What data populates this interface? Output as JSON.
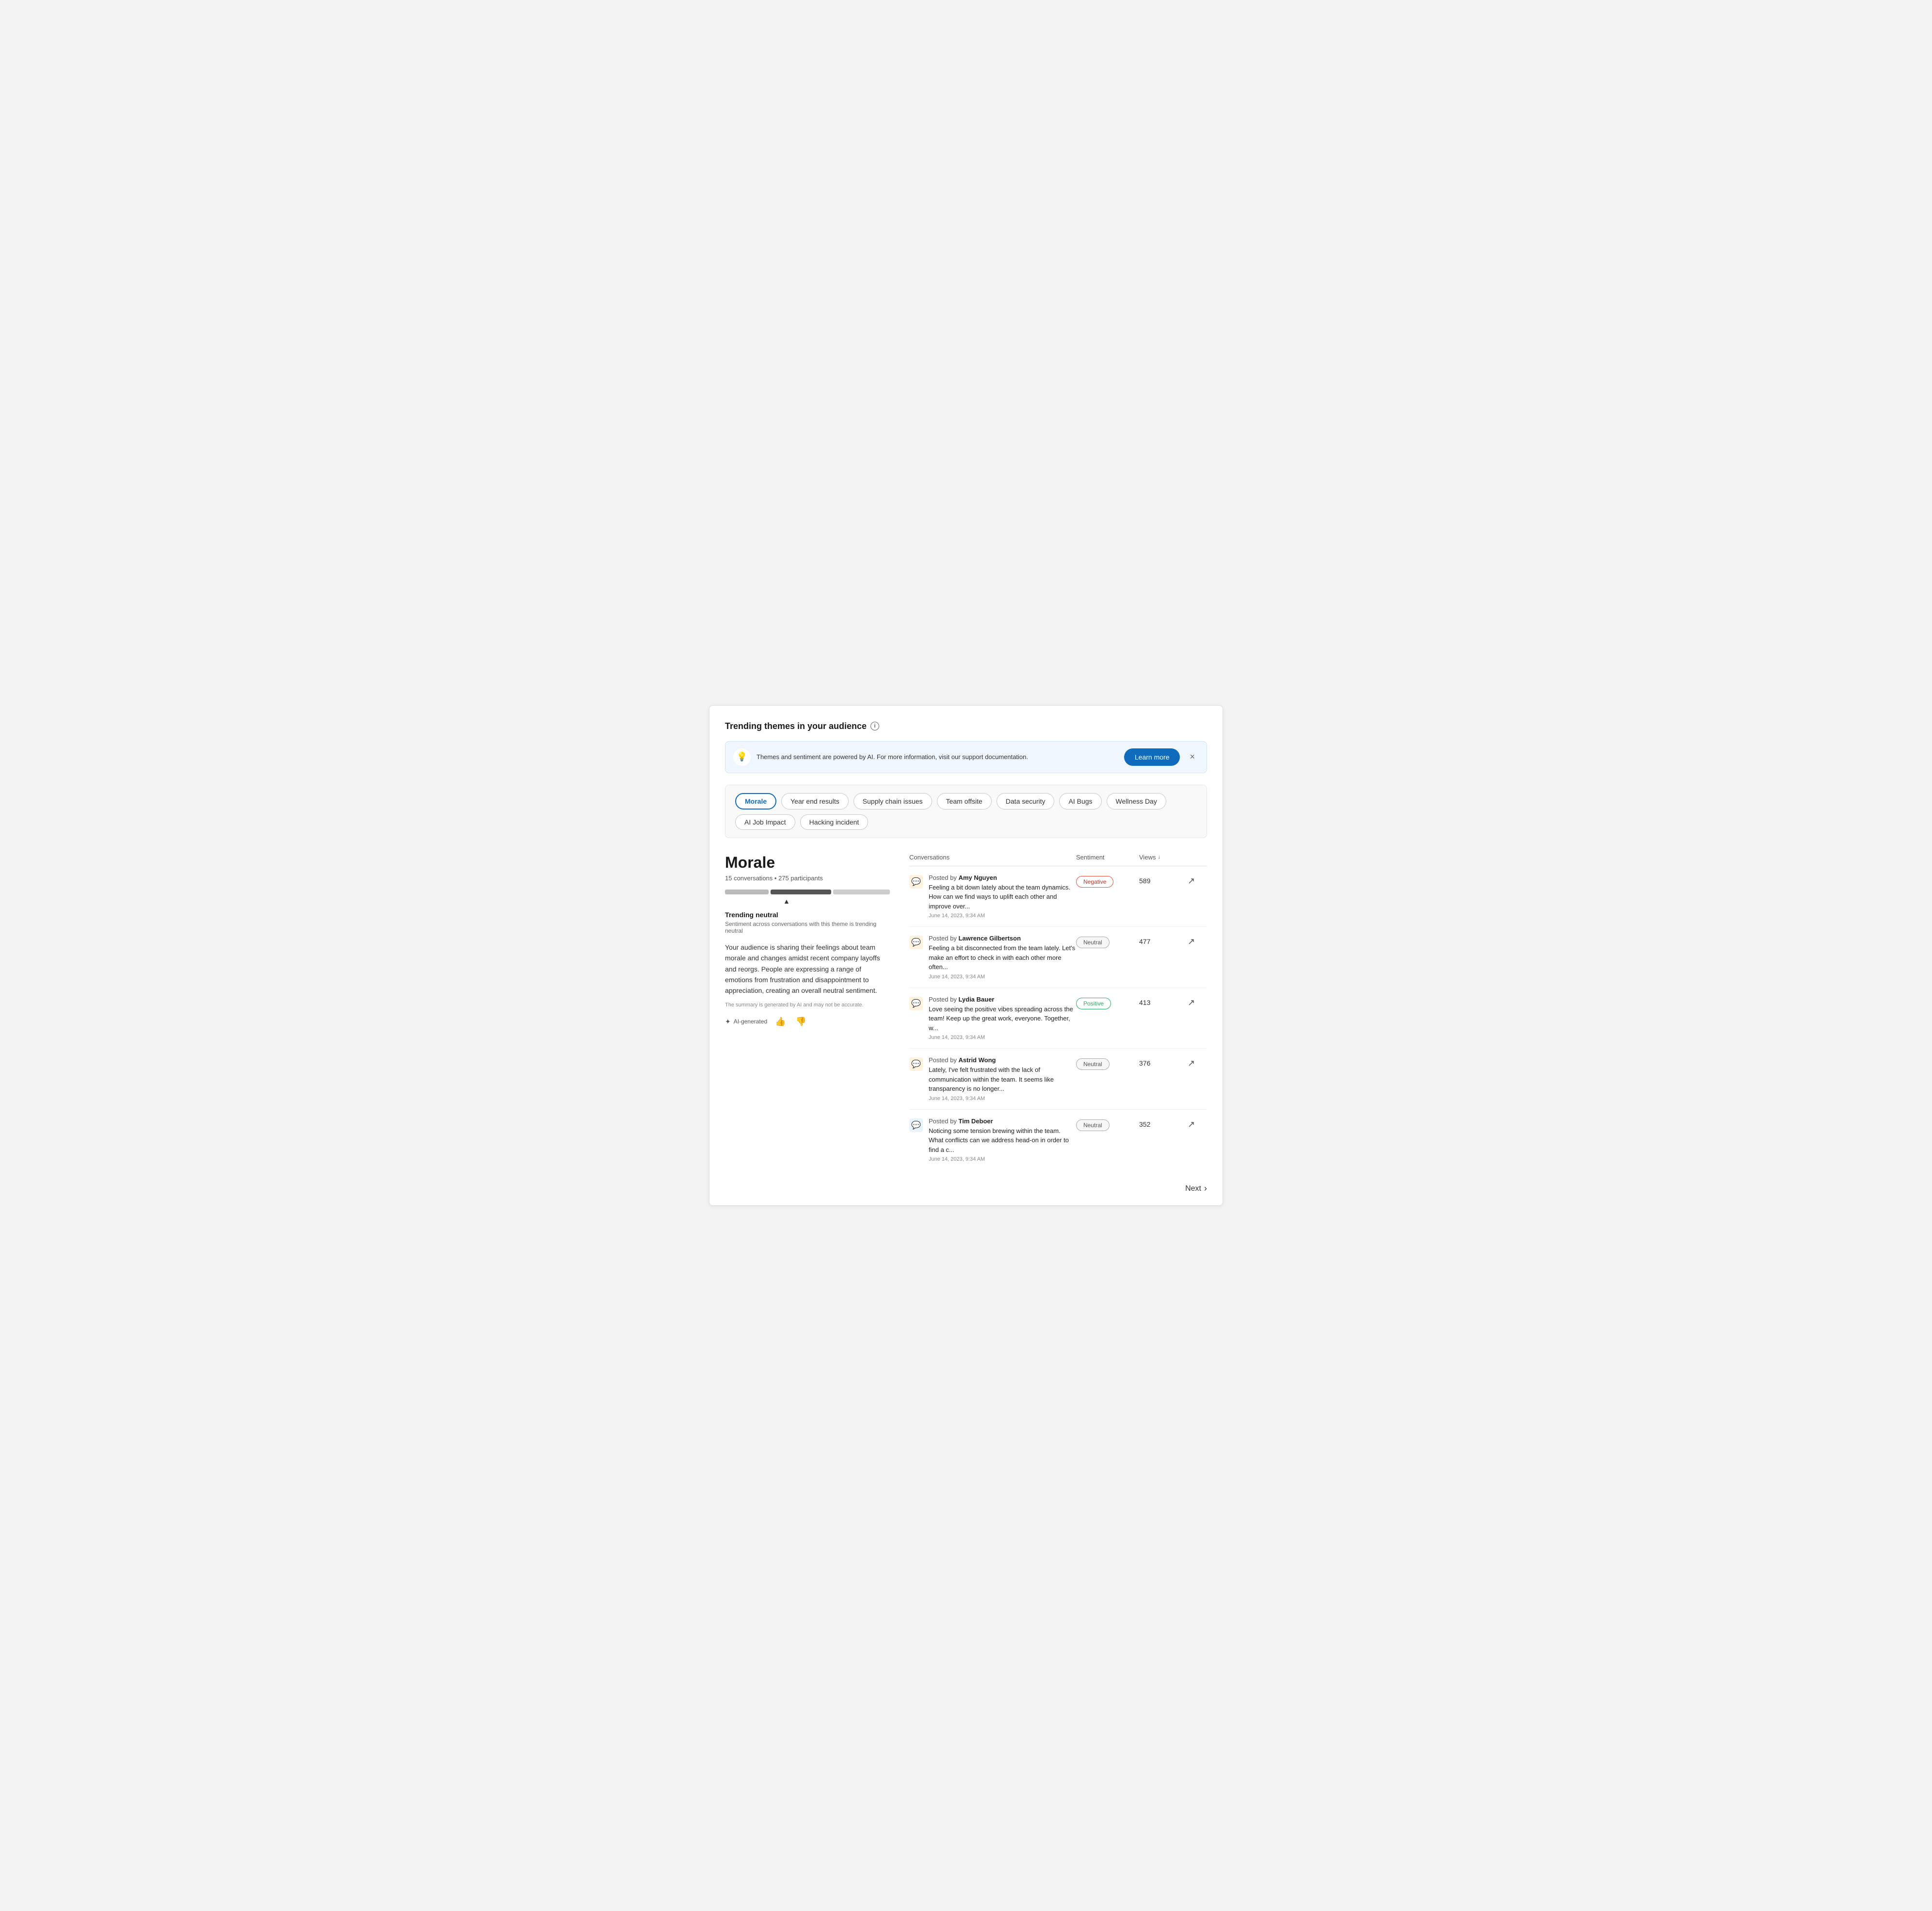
{
  "page": {
    "title": "Trending themes in your audience"
  },
  "banner": {
    "text": "Themes and sentiment are powered by AI. For more information, visit our support documentation.",
    "learn_more_label": "Learn more",
    "close_label": "×"
  },
  "themes": {
    "tags": [
      {
        "id": "morale",
        "label": "Morale",
        "active": true
      },
      {
        "id": "year-end-results",
        "label": "Year end results",
        "active": false
      },
      {
        "id": "supply-chain-issues",
        "label": "Supply chain issues",
        "active": false
      },
      {
        "id": "team-offsite",
        "label": "Team offsite",
        "active": false
      },
      {
        "id": "data-security",
        "label": "Data security",
        "active": false
      },
      {
        "id": "ai-bugs",
        "label": "AI Bugs",
        "active": false
      },
      {
        "id": "wellness-day",
        "label": "Wellness Day",
        "active": false
      },
      {
        "id": "ai-job-impact",
        "label": "AI Job Impact",
        "active": false
      },
      {
        "id": "hacking-incident",
        "label": "Hacking incident",
        "active": false
      }
    ]
  },
  "detail": {
    "title": "Morale",
    "conversations_count": "15 conversations",
    "participants_count": "275 participants",
    "trending_label": "Trending neutral",
    "trending_desc": "Sentiment across conversations with this theme is trending neutral",
    "description": "Your audience is sharing their feelings about team morale and changes amidst recent company layoffs and reorgs. People are expressing a range of emotions from frustration and disappointment to appreciation, creating an overall neutral sentiment.",
    "ai_disclaimer": "The summary is generated by AI and may not be accurate.",
    "ai_generated_label": "AI-generated",
    "thumbs_up": "👍",
    "thumbs_down": "👎"
  },
  "table": {
    "columns": {
      "conversations": "Conversations",
      "sentiment": "Sentiment",
      "views": "Views"
    },
    "rows": [
      {
        "posted_by_prefix": "Posted by",
        "author": "Amy Nguyen",
        "text": "Feeling a bit down lately about the team dynamics. How can we find ways to uplift each other and improve over...",
        "date": "June 14, 2023, 9:34 AM",
        "sentiment": "Negative",
        "sentiment_class": "negative",
        "views": "589",
        "icon_type": "orange"
      },
      {
        "posted_by_prefix": "Posted by",
        "author": "Lawrence Gilbertson",
        "text": "Feeling a bit disconnected from the team lately. Let's make an effort to check in with each other more often...",
        "date": "June 14, 2023, 9:34 AM",
        "sentiment": "Neutral",
        "sentiment_class": "neutral",
        "views": "477",
        "icon_type": "orange"
      },
      {
        "posted_by_prefix": "Posted by",
        "author": "Lydia Bauer",
        "text": "Love seeing the positive vibes spreading across the team! Keep up the great work, everyone. Together, w...",
        "date": "June 14, 2023, 9:34 AM",
        "sentiment": "Positive",
        "sentiment_class": "positive",
        "views": "413",
        "icon_type": "orange"
      },
      {
        "posted_by_prefix": "Posted by",
        "author": "Astrid Wong",
        "text": "Lately, I've felt frustrated with the lack of communication within the team. It seems like transparency is no longer...",
        "date": "June 14, 2023, 9:34 AM",
        "sentiment": "Neutral",
        "sentiment_class": "neutral",
        "views": "376",
        "icon_type": "orange"
      },
      {
        "posted_by_prefix": "Posted by",
        "author": "Tim Deboer",
        "text": "Noticing some tension brewing within the team. What conflicts can we address head-on in order to find a c...",
        "date": "June 14, 2023, 9:34 AM",
        "sentiment": "Neutral",
        "sentiment_class": "neutral",
        "views": "352",
        "icon_type": "blue"
      }
    ]
  },
  "footer": {
    "next_label": "Next"
  }
}
